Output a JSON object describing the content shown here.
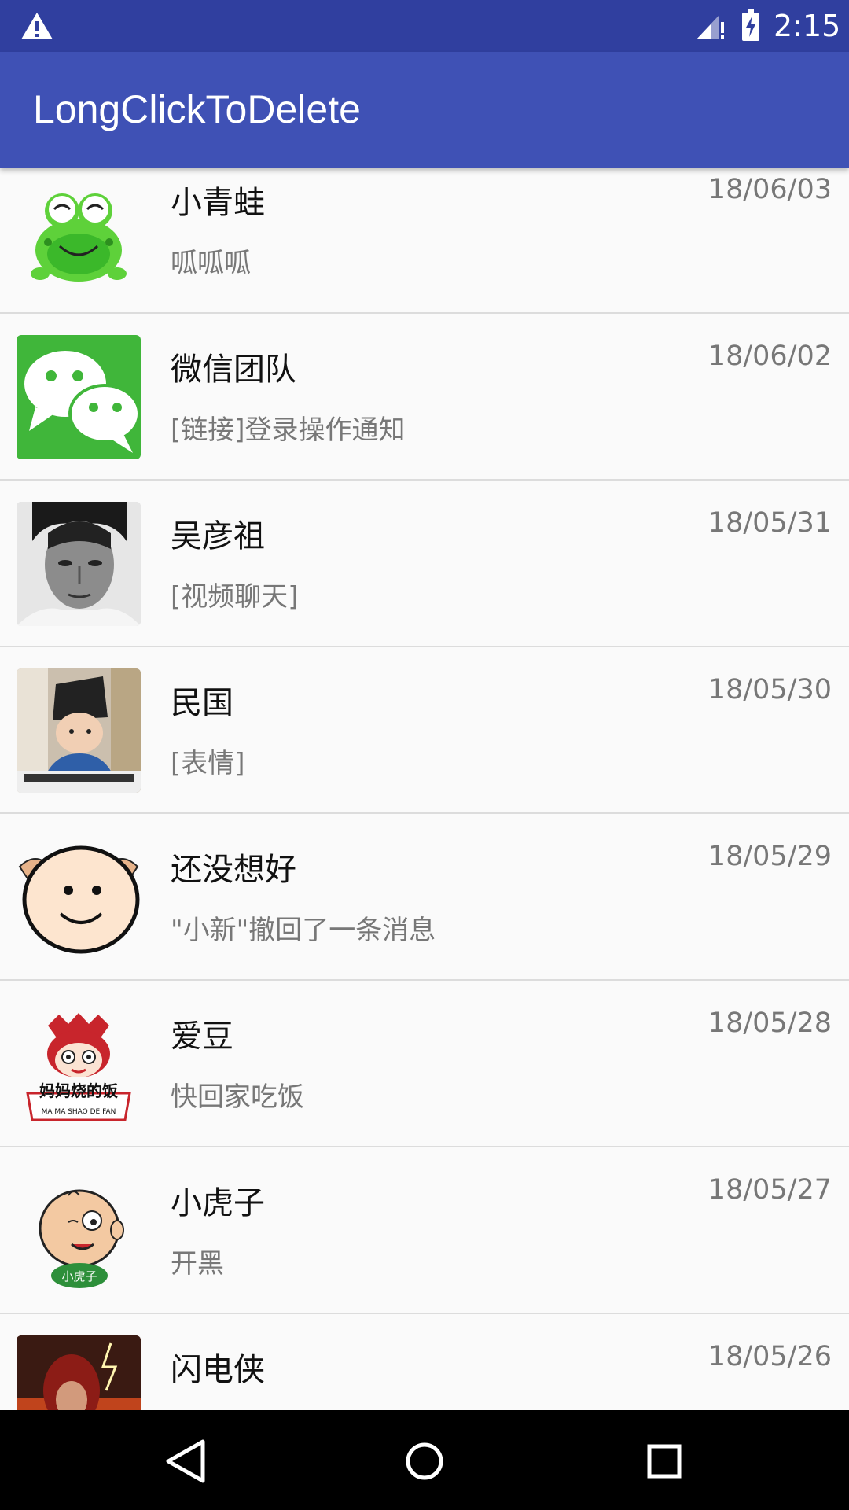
{
  "status_bar": {
    "time": "2:15",
    "warning_icon": "warning-icon",
    "signal_icon": "signal-icon",
    "battery_icon": "battery-charging-icon"
  },
  "app_bar": {
    "title": "LongClickToDelete",
    "color": "#3f51b5",
    "status_color": "#303f9f"
  },
  "conversations": [
    {
      "name": "小青蛙",
      "message": "呱呱呱",
      "date": "18/06/03",
      "avatar": "frog-avatar"
    },
    {
      "name": "微信团队",
      "message": "[链接]登录操作通知",
      "date": "18/06/02",
      "avatar": "wechat-avatar"
    },
    {
      "name": "吴彦祖",
      "message": "[视频聊天]",
      "date": "18/05/31",
      "avatar": "portrait-avatar"
    },
    {
      "name": "民国",
      "message": "[表情]",
      "date": "18/05/30",
      "avatar": "child-avatar"
    },
    {
      "name": "还没想好",
      "message": "\"小新\"撤回了一条消息",
      "date": "18/05/29",
      "avatar": "smiley-avatar"
    },
    {
      "name": "爱豆",
      "message": "快回家吃饭",
      "date": "18/05/28",
      "avatar": "mama-logo-avatar"
    },
    {
      "name": "小虎子",
      "message": "开黑",
      "date": "18/05/27",
      "avatar": "cartoon-boy-avatar"
    },
    {
      "name": "闪电侠",
      "message": "",
      "date": "18/05/26",
      "avatar": "flash-avatar"
    }
  ],
  "avatar_text": {
    "mama_logo": "妈妈烧的饭",
    "mama_sub": "MA MA SHAO DE FAN",
    "tiger_badge": "小虎子"
  },
  "nav_bar": {
    "back_icon": "back-icon",
    "home_icon": "home-icon",
    "recents_icon": "recents-icon"
  }
}
